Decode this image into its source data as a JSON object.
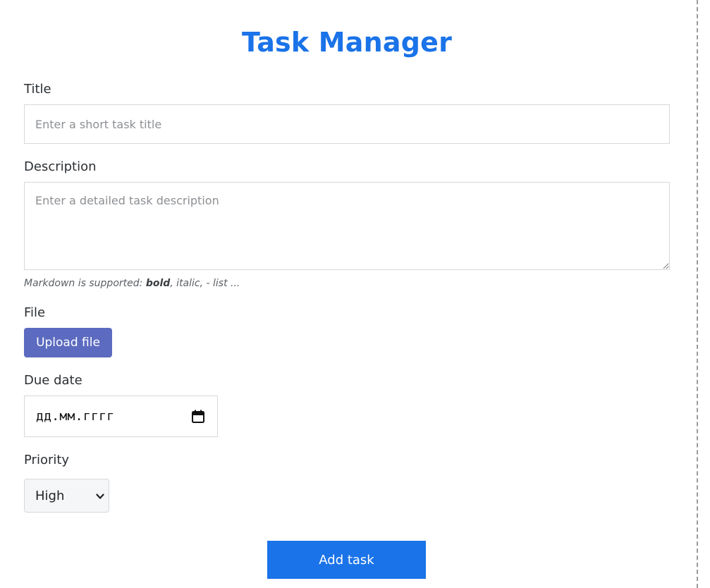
{
  "header": {
    "title": "Task Manager"
  },
  "form": {
    "title_label": "Title",
    "title_placeholder": "Enter a short task title",
    "description_label": "Description",
    "description_placeholder": "Enter a detailed task description",
    "hint": {
      "prefix": "Markdown is supported: ",
      "bold": "bold",
      "suffix": ", italic, - list ..."
    },
    "file_label": "File",
    "upload_label": "Upload file",
    "due_date_label": "Due date",
    "due_date_value": "дд.мм.гггг",
    "priority_label": "Priority",
    "priority_value": "High",
    "submit_label": "Add task"
  },
  "colors": {
    "accent": "#1a73e8",
    "upload_button": "#5c6bc0"
  }
}
